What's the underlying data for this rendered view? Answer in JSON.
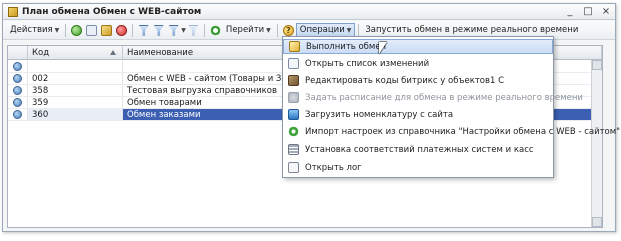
{
  "window": {
    "title": "План обмена Обмен с WEB-сайтом",
    "controls": [
      "_",
      "□",
      "×"
    ]
  },
  "toolbar": {
    "actions_label": "Действия",
    "goto_label": "Перейти",
    "operations_label": "Операции",
    "realtime_label": "Запустить обмен в режиме реального времени"
  },
  "grid": {
    "columns": {
      "code": "Код",
      "name": "Наименование"
    },
    "rows": [
      {
        "code": "",
        "name": ""
      },
      {
        "code": "002",
        "name": "Обмен с WEB - сайтом (Товары и Заказ"
      },
      {
        "code": "358",
        "name": "Тестовая выгрузка справочников"
      },
      {
        "code": "359",
        "name": "Обмен товарами"
      },
      {
        "code": "360",
        "name": "Обмен заказами"
      }
    ]
  },
  "operations_menu": {
    "items": [
      {
        "label": "Выполнить обмен",
        "icon": "run-exchange-icon",
        "state": "hovered"
      },
      {
        "label": "Открыть список изменений",
        "icon": "list-icon",
        "state": "normal"
      },
      {
        "label": "Редактировать коды битрикс у объектов1 С",
        "icon": "tools-icon",
        "state": "normal"
      },
      {
        "label": "Задать расписание для обмена в режиме реального времени",
        "icon": "schedule-icon",
        "state": "disabled"
      },
      {
        "label": "Загрузить номенклатуру с сайта",
        "icon": "download-icon",
        "state": "normal"
      },
      {
        "label": "Импорт настроек из справочника \"Настройки обмена с WEB - сайтом\"",
        "icon": "import-icon",
        "state": "normal"
      },
      {
        "label": "Установка соответствий платежных систем и касс",
        "icon": "payment-mapping-icon",
        "state": "normal"
      },
      {
        "label": "Открыть лог",
        "icon": "log-icon",
        "state": "normal"
      }
    ]
  }
}
